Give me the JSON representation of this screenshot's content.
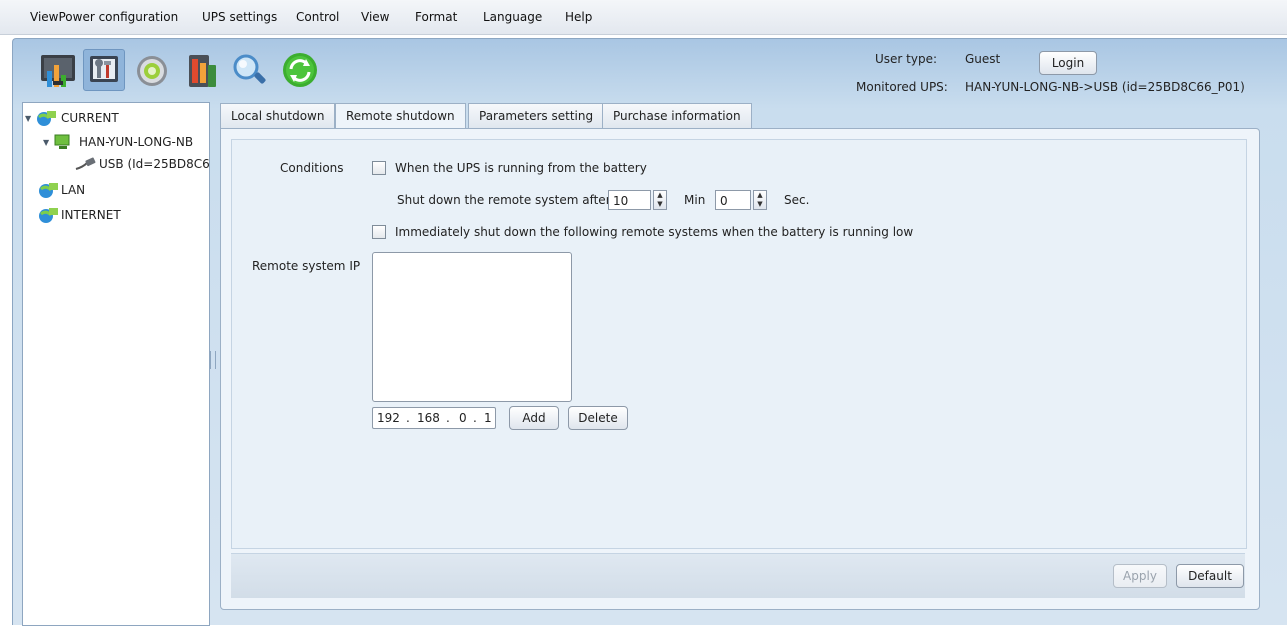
{
  "menu": [
    "ViewPower configuration",
    "UPS settings",
    "Control",
    "View",
    "Format",
    "Language",
    "Help"
  ],
  "toolbar": {
    "icons": [
      "monitor-chart-icon",
      "tools-settings-icon",
      "gear-disc-icon",
      "ups-battery-icon",
      "magnifier-search-icon",
      "refresh-icon"
    ]
  },
  "user": {
    "type_label": "User type:",
    "type_value": "Guest",
    "login_label": "Login",
    "monitored_label": "Monitored UPS:",
    "monitored_value": "HAN-YUN-LONG-NB->USB (id=25BD8C66_P01)"
  },
  "tree": {
    "current": "CURRENT",
    "host": "HAN-YUN-LONG-NB",
    "usb": "USB (Id=25BD8C6",
    "lan": "LAN",
    "internet": "INTERNET"
  },
  "tabs": [
    "Local shutdown",
    "Remote shutdown",
    "Parameters setting",
    "Purchase information"
  ],
  "active_tab": "Remote shutdown",
  "form": {
    "conditions_label": "Conditions",
    "battery_check_label": "When the UPS is running from the battery",
    "shutdown_after_label": "Shut down the remote system after",
    "min_value": "10",
    "min_label": "Min",
    "sec_value": "0",
    "sec_label": "Sec.",
    "low_battery_check_label": "Immediately shut down the following remote systems when the battery is running low",
    "remote_ip_label": "Remote system IP",
    "ip": [
      "192",
      "168",
      "0",
      "1"
    ],
    "add_label": "Add",
    "delete_label": "Delete"
  },
  "footer": {
    "apply_label": "Apply",
    "default_label": "Default"
  },
  "colors": {
    "frame_blue": "#c9ddee",
    "panel_bg": "#eef4fa",
    "refresh_green": "#3cae2f"
  }
}
